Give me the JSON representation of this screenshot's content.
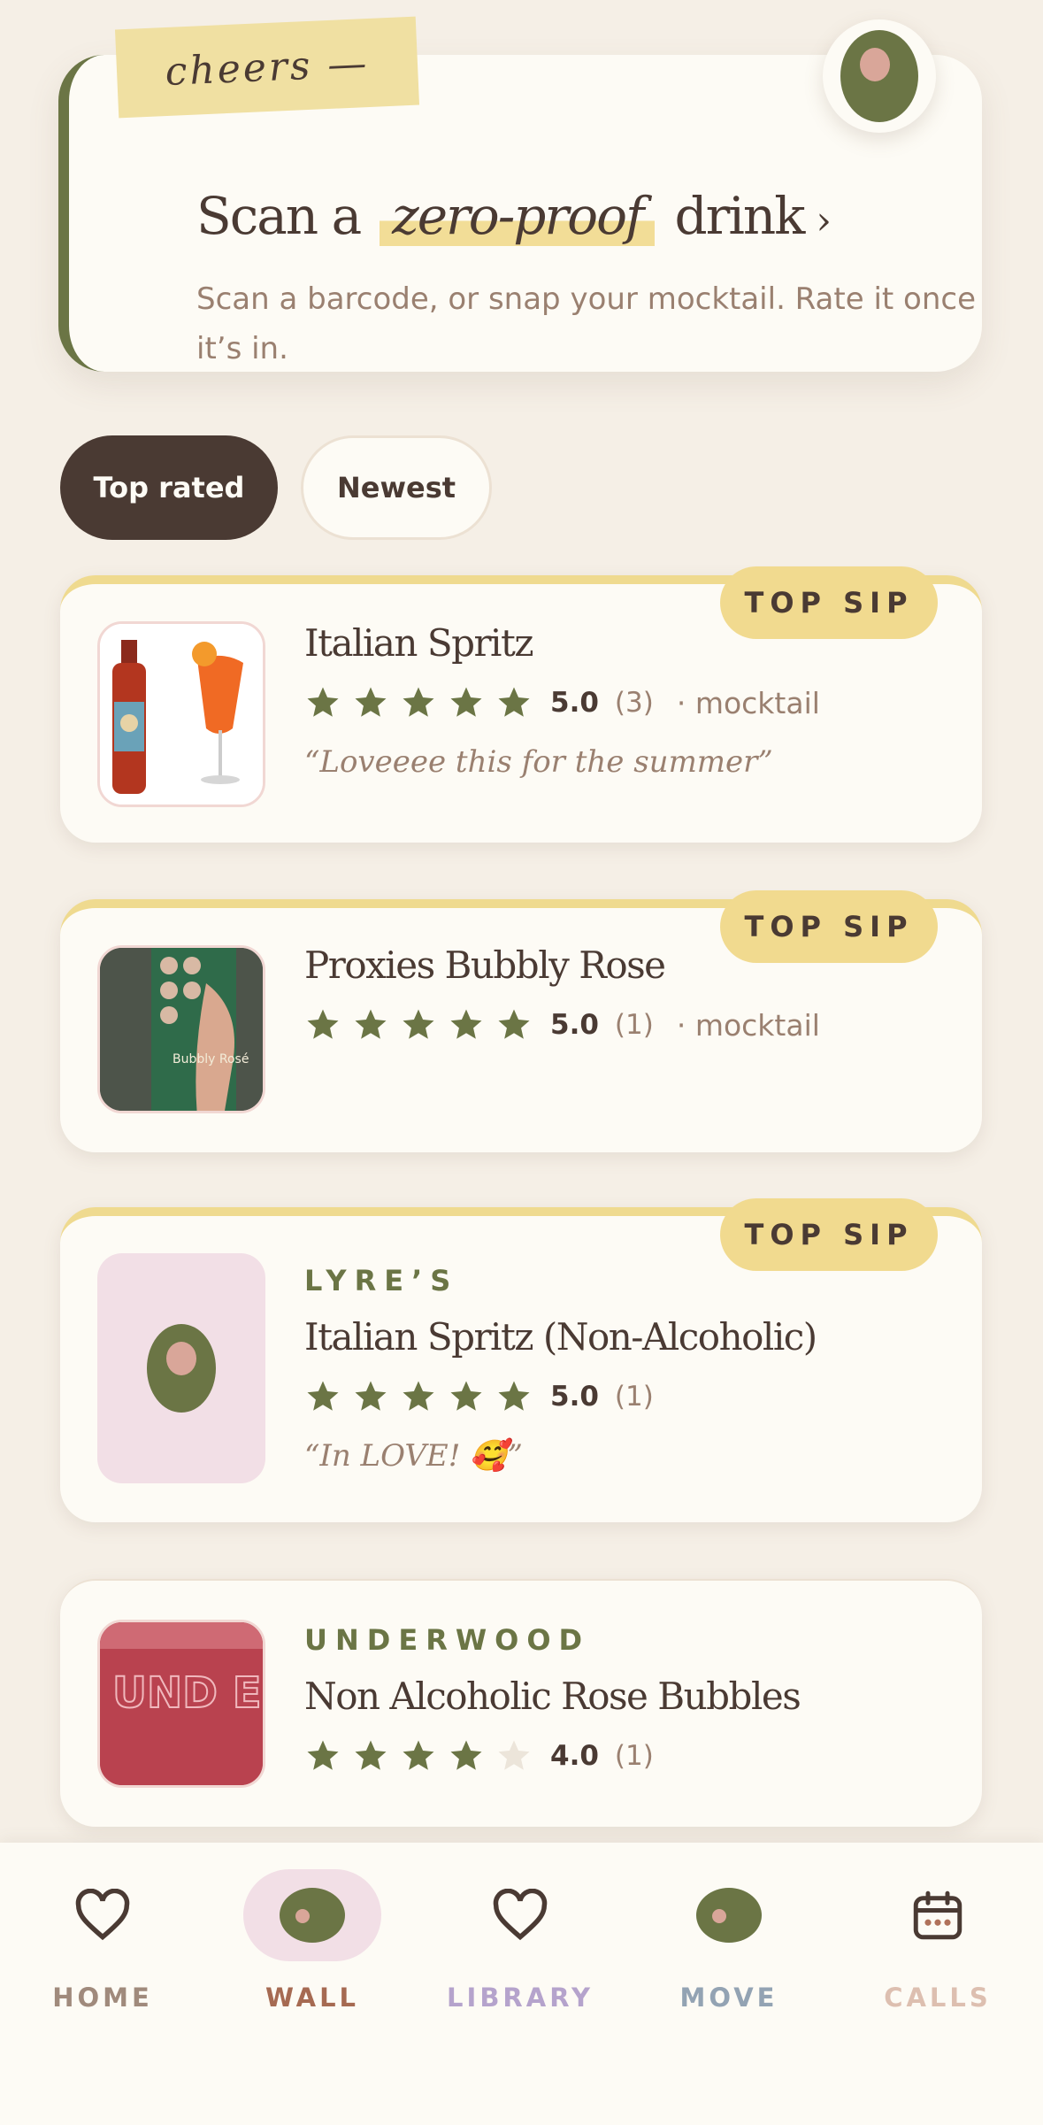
{
  "hero": {
    "tape_label": "cheers —",
    "title_before": "Scan a",
    "title_highlight": "zero-proof",
    "title_after": "drink",
    "title_chevron": "›",
    "subtitle": "Scan a barcode, or snap your mocktail. Rate it once it’s in."
  },
  "filters": {
    "top_rated": "Top rated",
    "newest": "Newest"
  },
  "badge_label": "TOP SIP",
  "drinks": [
    {
      "name": "Italian Spritz",
      "score": "5.0",
      "count": "(3)",
      "type": "· mocktail",
      "quote": "“Loveeee this for the summer”",
      "stars": 5
    },
    {
      "name": "Proxies Bubbly Rose",
      "score": "5.0",
      "count": "(1)",
      "type": "· mocktail",
      "stars": 5,
      "thumb_text": "Bubbly Rosé"
    },
    {
      "brand": "LYRE’S",
      "name": "Italian Spritz (Non-Alcoholic)",
      "score": "5.0",
      "count": "(1)",
      "quote": "“In LOVE! 🥰”",
      "stars": 5
    },
    {
      "brand": "UNDERWOOD",
      "name": "Non Alcoholic Rose Bubbles",
      "score": "4.0",
      "count": "(1)",
      "stars": 4,
      "thumb_text": "UND ERW"
    }
  ],
  "nav": [
    {
      "label": "HOME",
      "color": "#a08a7c"
    },
    {
      "label": "WALL",
      "color": "#a66a52"
    },
    {
      "label": "LIBRARY",
      "color": "#b5a3cc"
    },
    {
      "label": "MOVE",
      "color": "#93a3b3"
    },
    {
      "label": "CALLS",
      "color": "#ddbfb0"
    }
  ],
  "colors": {
    "accent_olive": "#6b7545",
    "tape_yellow": "#f0e0a2",
    "badge_yellow": "#f1da8f",
    "dark_brown": "#4a3a33",
    "card_bg": "#fdfbf5",
    "page_bg": "#f5efe6",
    "star_empty": "#ece5da"
  }
}
